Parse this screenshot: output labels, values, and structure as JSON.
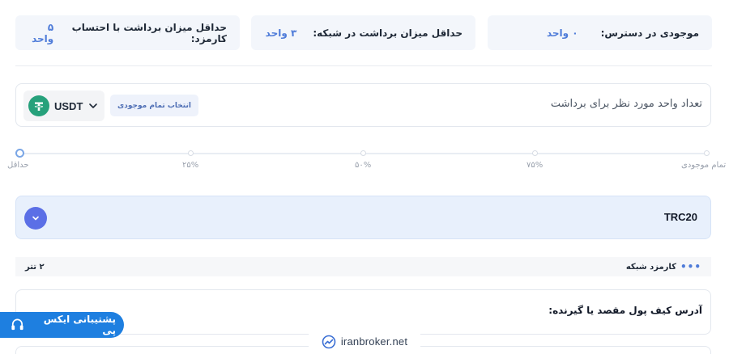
{
  "info_cards": [
    {
      "label": "موجودی در دسترس:",
      "value": "۰ واحد"
    },
    {
      "label": "حداقل میزان برداشت در شبکه:",
      "value": "۳ واحد"
    },
    {
      "label": "حداقل میزان برداشت با احتساب کارمزد:",
      "value": "۵ واحد"
    }
  ],
  "amount": {
    "label": "تعداد واحد مورد نظر برای برداشت",
    "all_balance_button": "انتخاب تمام موجودی",
    "coin": "USDT",
    "coin_icon": "tether-icon",
    "coin_color": "#26a17b"
  },
  "slider": {
    "value_percent": 0,
    "ticks": [
      "حداقل",
      "۲۵%",
      "۵۰%",
      "۷۵%",
      "تمام موجودی"
    ]
  },
  "network": {
    "name": "TRC20",
    "toggle_icon": "chevron-down-icon",
    "accent": "#5b6fe6"
  },
  "fee": {
    "label": "کارمزد شبکه",
    "value": "۲ تتر"
  },
  "address": {
    "label": "آدرس کیف پول مقصد یا گیرنده:"
  },
  "support": {
    "label": "پشتیبانی ایکس پی",
    "icon": "headset-icon",
    "color": "#1e7fe0"
  },
  "watermark": {
    "text": "iranbroker.net"
  }
}
